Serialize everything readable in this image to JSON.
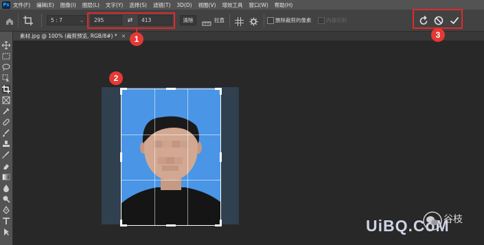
{
  "menubar": {
    "logo": "Ps",
    "items": [
      "文件(F)",
      "编辑(E)",
      "图像(I)",
      "图层(L)",
      "文字(Y)",
      "选择(S)",
      "滤镜(T)",
      "3D(D)",
      "视图(V)",
      "增效工具",
      "窗口(W)",
      "帮助(H)"
    ]
  },
  "options": {
    "ratio": "5 : 7",
    "width_value": "295",
    "height_value": "413",
    "clear_label": "清除",
    "straighten_label": "拉直",
    "delete_cropped_label": "删除裁剪的像素",
    "content_aware_label": "内容识别",
    "swap_glyph": "⇄"
  },
  "document": {
    "tab_label": "素材.jpg @ 100% (裁剪预览, RGB/8#) *",
    "close_glyph": "×"
  },
  "annotations": {
    "callout_1": "1",
    "callout_2": "2",
    "callout_3": "3"
  },
  "watermark": {
    "text": "UiBQ.CoM",
    "cn_text": "谷枝"
  },
  "icons": {
    "toolbar": [
      "move-icon",
      "marquee-icon",
      "lasso-icon",
      "object-select-icon",
      "crop-icon",
      "frame-icon",
      "eyedropper-icon",
      "healing-brush-icon",
      "brush-icon",
      "stamp-icon",
      "history-brush-icon",
      "eraser-icon",
      "gradient-icon",
      "blur-icon",
      "dodge-icon",
      "pen-icon",
      "type-icon",
      "path-select-icon"
    ]
  },
  "colors": {
    "accent_red": "#e2292c",
    "photo_bg": "#4a95e6",
    "canvas_rect": "#30404f"
  }
}
